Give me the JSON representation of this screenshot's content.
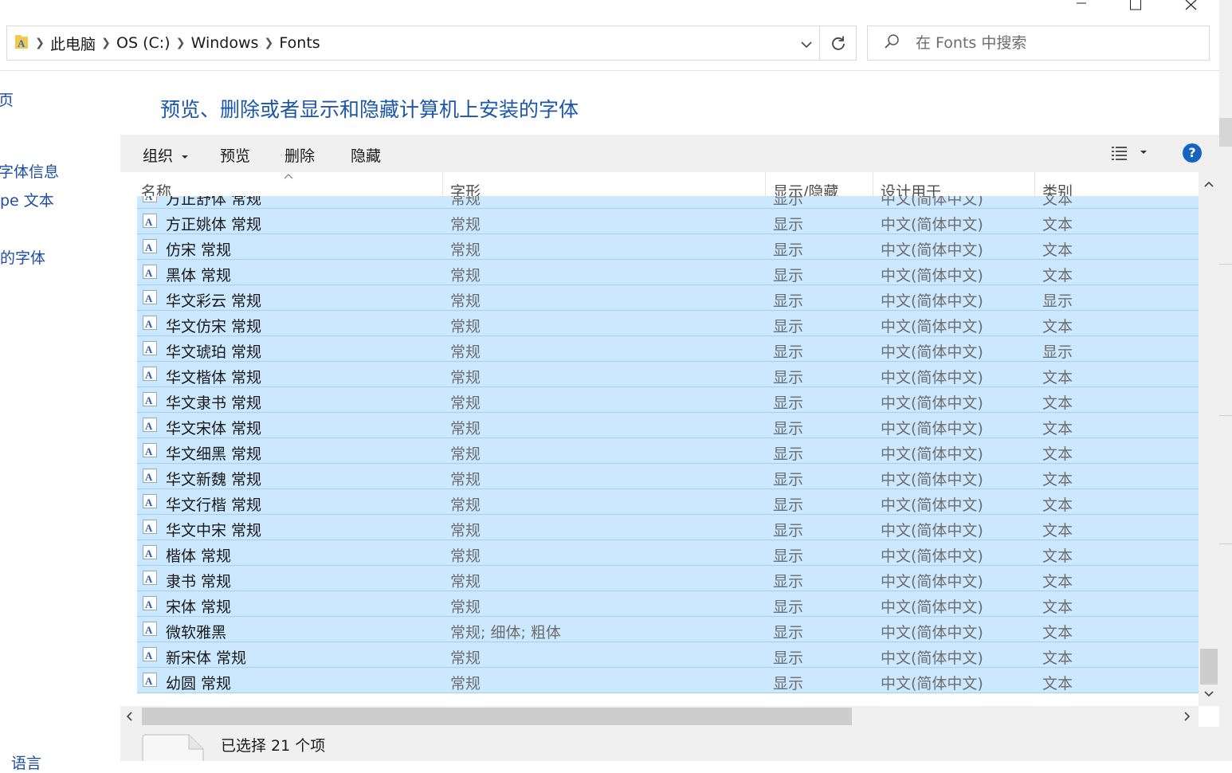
{
  "window": {
    "controls": [
      "minimize-icon",
      "maximize-icon",
      "close-icon"
    ]
  },
  "address": {
    "crumbs": [
      "此电脑",
      "OS (C:)",
      "Windows",
      "Fonts"
    ]
  },
  "search": {
    "placeholder": "在 Fonts 中搜索"
  },
  "left_pane": {
    "items": [
      "页",
      "字体信息",
      "pe 文本",
      "的字体",
      "语言"
    ]
  },
  "heading": "预览、删除或者显示和隐藏计算机上安装的字体",
  "toolbar": {
    "organize": "组织",
    "preview": "预览",
    "delete": "删除",
    "hide": "隐藏"
  },
  "columns": {
    "name": "名称",
    "style": "字形",
    "show_hide": "显示/隐藏",
    "designed_for": "设计用于",
    "category": "类别"
  },
  "rows": [
    {
      "name": "方正舒体 常规",
      "style": "常规",
      "show": "显示",
      "design": "中文(简体中文)",
      "category": "文本"
    },
    {
      "name": "方正姚体 常规",
      "style": "常规",
      "show": "显示",
      "design": "中文(简体中文)",
      "category": "文本"
    },
    {
      "name": "仿宋 常规",
      "style": "常规",
      "show": "显示",
      "design": "中文(简体中文)",
      "category": "文本"
    },
    {
      "name": "黑体 常规",
      "style": "常规",
      "show": "显示",
      "design": "中文(简体中文)",
      "category": "文本"
    },
    {
      "name": "华文彩云 常规",
      "style": "常规",
      "show": "显示",
      "design": "中文(简体中文)",
      "category": "显示"
    },
    {
      "name": "华文仿宋 常规",
      "style": "常规",
      "show": "显示",
      "design": "中文(简体中文)",
      "category": "文本"
    },
    {
      "name": "华文琥珀 常规",
      "style": "常规",
      "show": "显示",
      "design": "中文(简体中文)",
      "category": "显示"
    },
    {
      "name": "华文楷体 常规",
      "style": "常规",
      "show": "显示",
      "design": "中文(简体中文)",
      "category": "文本"
    },
    {
      "name": "华文隶书 常规",
      "style": "常规",
      "show": "显示",
      "design": "中文(简体中文)",
      "category": "文本"
    },
    {
      "name": "华文宋体 常规",
      "style": "常规",
      "show": "显示",
      "design": "中文(简体中文)",
      "category": "文本"
    },
    {
      "name": "华文细黑 常规",
      "style": "常规",
      "show": "显示",
      "design": "中文(简体中文)",
      "category": "文本"
    },
    {
      "name": "华文新魏 常规",
      "style": "常规",
      "show": "显示",
      "design": "中文(简体中文)",
      "category": "文本"
    },
    {
      "name": "华文行楷 常规",
      "style": "常规",
      "show": "显示",
      "design": "中文(简体中文)",
      "category": "文本"
    },
    {
      "name": "华文中宋 常规",
      "style": "常规",
      "show": "显示",
      "design": "中文(简体中文)",
      "category": "文本"
    },
    {
      "name": "楷体 常规",
      "style": "常规",
      "show": "显示",
      "design": "中文(简体中文)",
      "category": "文本"
    },
    {
      "name": "隶书 常规",
      "style": "常规",
      "show": "显示",
      "design": "中文(简体中文)",
      "category": "文本"
    },
    {
      "name": "宋体 常规",
      "style": "常规",
      "show": "显示",
      "design": "中文(简体中文)",
      "category": "文本"
    },
    {
      "name": "微软雅黑",
      "style": "常规; 细体; 粗体",
      "show": "显示",
      "design": "中文(简体中文)",
      "category": "文本"
    },
    {
      "name": "新宋体 常规",
      "style": "常规",
      "show": "显示",
      "design": "中文(简体中文)",
      "category": "文本"
    },
    {
      "name": "幼圆 常规",
      "style": "常规",
      "show": "显示",
      "design": "中文(简体中文)",
      "category": "文本"
    }
  ],
  "status": {
    "selected": "已选择 21 个项"
  },
  "colors": {
    "selection_bg": "#cce8ff",
    "selection_border": "#99d1ff",
    "heading": "#1b56a8",
    "help": "#1565c0"
  }
}
